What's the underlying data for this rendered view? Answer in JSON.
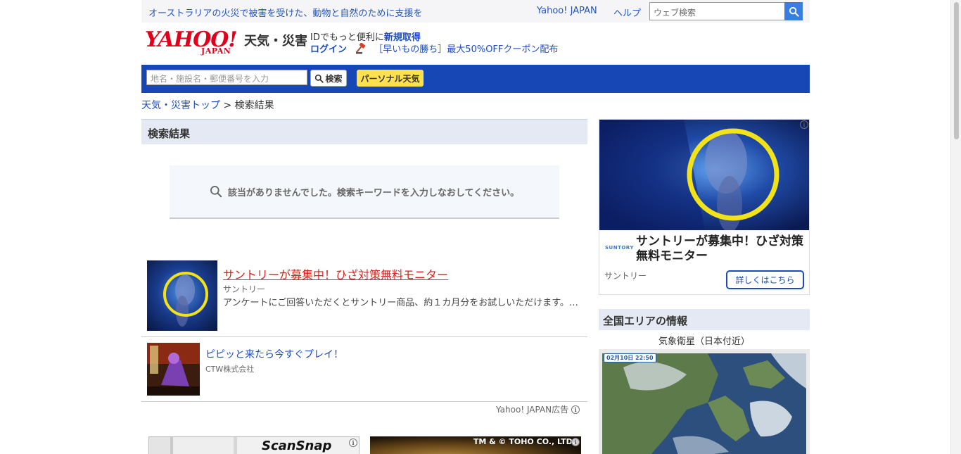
{
  "topbar": {
    "promo": "オーストラリアの火災で被害を受けた、動物と自然のために支援を",
    "yahoo_japan": "Yahoo! JAPAN",
    "help": "ヘルプ",
    "search_placeholder": "ウェブ検索"
  },
  "header": {
    "logo_word": "YAHOO!",
    "logo_japan": "JAPAN",
    "section_title": "天気・災害",
    "id_promo_text": "IDでもっと便利に",
    "register_link": "新規取得",
    "login_link": "ログイン",
    "auction_link": "［早いもの勝ち］最大50%OFFクーポン配布"
  },
  "bluebar": {
    "location_placeholder": "地名・施設名・郵便番号を入力",
    "search_button": "検索",
    "personal_button": "パーソナル天気"
  },
  "breadcrumb": {
    "home": "天気・災害トップ",
    "separator": " > ",
    "current": "検索結果"
  },
  "main": {
    "results_heading": "検索結果",
    "no_result_message": "該当がありませんでした。検索キーワードを入力しなおしてください。",
    "ads": [
      {
        "title": "サントリーが募集中！ひざ対策無料モニター",
        "advertiser": "サントリー",
        "description": "アンケートにご回答いただくとサントリー商品、約１カ月分をお試しいただけます。…"
      },
      {
        "title": "ピピッと来たら今すぐプレイ！",
        "advertiser": "CTW株式会社"
      }
    ],
    "ad_label": "Yahoo! JAPAN広告",
    "banners": {
      "scansnap_brand": "ScanSnap",
      "toho_tm": "TM & © TOHO CO., LTD."
    }
  },
  "sidebar": {
    "ad": {
      "brand_logo": "SUNTORY",
      "title": "サントリーが募集中！ひざ対策無料モニター",
      "advertiser": "サントリー",
      "cta": "詳しくはこちら"
    },
    "area_heading": "全国エリアの情報",
    "satellite_caption": "気象衛星（日本付近）",
    "satellite_date": "02月10日 22:50"
  },
  "colors": {
    "brand_red": "#e0001c",
    "nav_blue": "#1647b5",
    "link_blue": "#1a4cc1",
    "ad_title_red": "#d8221e",
    "personal_yellow": "#ffe14f",
    "section_bg": "#e4e9f3"
  },
  "icons": [
    "search-icon",
    "gavel-icon",
    "info-icon"
  ]
}
